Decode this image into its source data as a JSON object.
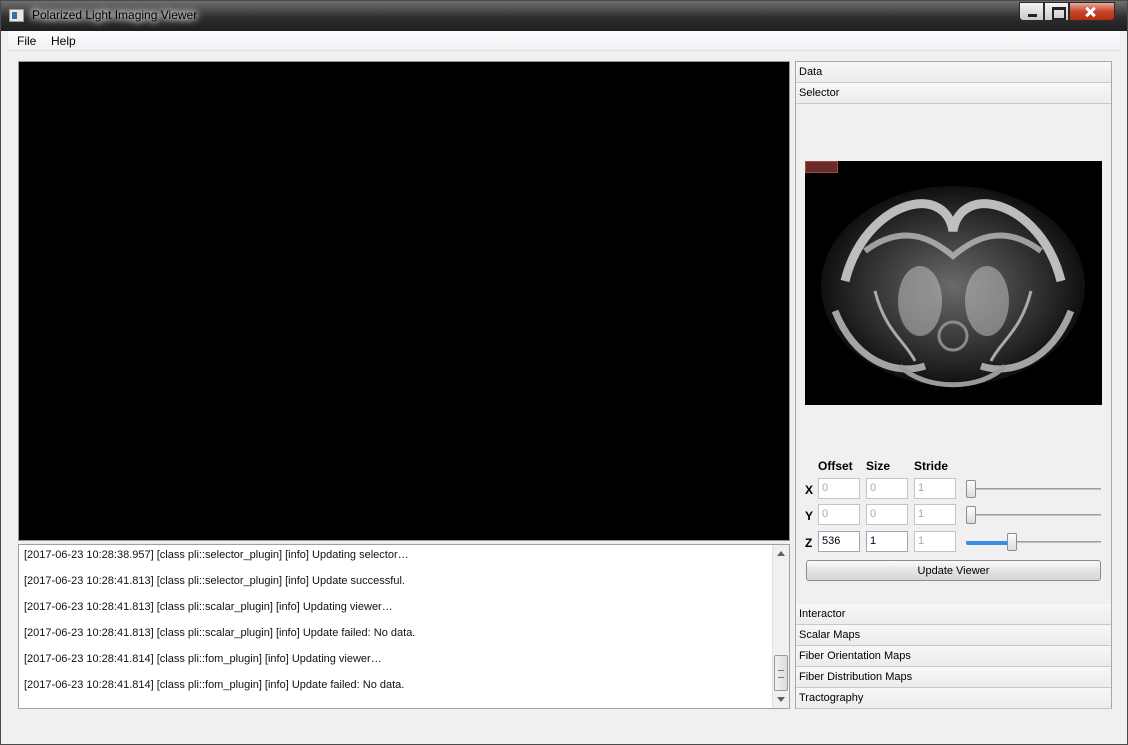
{
  "window": {
    "title": "Polarized Light Imaging Viewer"
  },
  "menu": {
    "file": "File",
    "help": "Help"
  },
  "log": {
    "lines": [
      "[2017-06-23 10:28:38.957] [class pli::selector_plugin] [info] Updating selector…",
      "[2017-06-23 10:28:41.813] [class pli::selector_plugin] [info] Update successful.",
      "[2017-06-23 10:28:41.813] [class pli::scalar_plugin] [info] Updating viewer…",
      "[2017-06-23 10:28:41.813] [class pli::scalar_plugin] [info] Update failed: No data.",
      "[2017-06-23 10:28:41.814] [class pli::fom_plugin] [info] Updating viewer…",
      "[2017-06-23 10:28:41.814] [class pli::fom_plugin] [info] Update failed: No data."
    ]
  },
  "sidebar": {
    "sections_top": [
      "Data",
      "Selector"
    ],
    "sections_bottom": [
      "Interactor",
      "Scalar Maps",
      "Fiber Orientation Maps",
      "Fiber Distribution Maps",
      "Tractography"
    ],
    "selector": {
      "columns": {
        "offset": "Offset",
        "size": "Size",
        "stride": "Stride"
      },
      "rows": [
        {
          "axis": "X",
          "offset": "0",
          "size": "0",
          "stride": "1",
          "slider_fraction": 0.0
        },
        {
          "axis": "Y",
          "offset": "0",
          "size": "0",
          "stride": "1",
          "slider_fraction": 0.0
        },
        {
          "axis": "Z",
          "offset": "536",
          "size": "1",
          "stride": "1",
          "slider_fraction": 0.33
        }
      ],
      "update_button": "Update Viewer",
      "accent_color": "#3a8ee6"
    }
  }
}
